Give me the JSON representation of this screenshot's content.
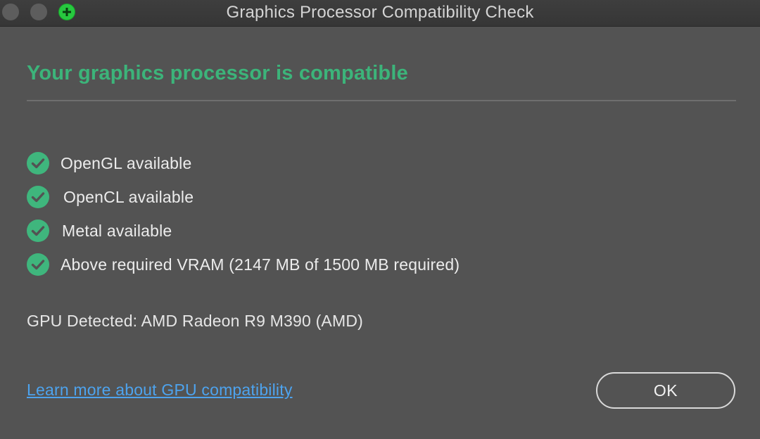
{
  "window": {
    "title": "Graphics Processor Compatibility Check",
    "controls": {
      "close": "close-icon",
      "minimize": "minimize-icon",
      "zoom": "zoom-icon"
    }
  },
  "main": {
    "heading": "Your graphics processor is compatible",
    "checks": [
      {
        "label": "OpenGL available",
        "icon": "check-circle-icon"
      },
      {
        "label": "OpenCL available",
        "icon": "check-circle-icon"
      },
      {
        "label": "Metal available",
        "icon": "check-circle-icon"
      },
      {
        "label": "Above required VRAM (2147 MB of 1500 MB required)",
        "icon": "check-circle-icon"
      }
    ],
    "gpu_detected": "GPU Detected: AMD Radeon R9 M390 (AMD)"
  },
  "footer": {
    "link_text": "Learn more about GPU compatibility",
    "ok_label": "OK"
  },
  "colors": {
    "background": "#535353",
    "heading_green": "#3cb47a",
    "check_green": "#3fb67d",
    "link_blue": "#4da3ee",
    "zoom_green": "#27c93f"
  }
}
